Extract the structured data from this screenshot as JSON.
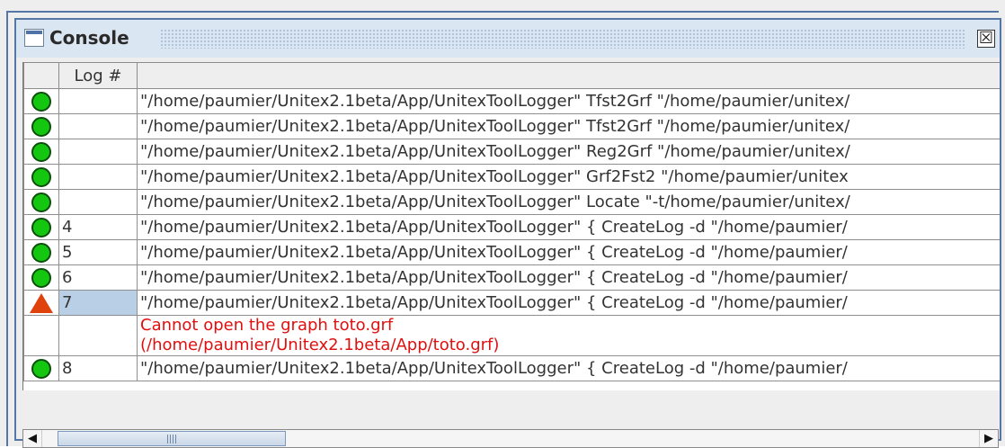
{
  "window": {
    "title": "Console",
    "close_icon": "close-icon"
  },
  "table": {
    "headers": [
      "",
      "Log #",
      ""
    ],
    "rows": [
      {
        "status": "ok",
        "log": "",
        "command": "\"/home/paumier/Unitex2.1beta/App/UnitexToolLogger\" Tfst2Grf \"/home/paumier/unitex/"
      },
      {
        "status": "ok",
        "log": "",
        "command": "\"/home/paumier/Unitex2.1beta/App/UnitexToolLogger\" Tfst2Grf \"/home/paumier/unitex/"
      },
      {
        "status": "ok",
        "log": "",
        "command": "\"/home/paumier/Unitex2.1beta/App/UnitexToolLogger\" Reg2Grf \"/home/paumier/unitex/"
      },
      {
        "status": "ok",
        "log": "",
        "command": "\"/home/paumier/Unitex2.1beta/App/UnitexToolLogger\" Grf2Fst2 \"/home/paumier/unitex"
      },
      {
        "status": "ok",
        "log": "",
        "command": "\"/home/paumier/Unitex2.1beta/App/UnitexToolLogger\" Locate \"-t/home/paumier/unitex/"
      },
      {
        "status": "ok",
        "log": "4",
        "command": "\"/home/paumier/Unitex2.1beta/App/UnitexToolLogger\" { CreateLog -d \"/home/paumier/"
      },
      {
        "status": "ok",
        "log": "5",
        "command": "\"/home/paumier/Unitex2.1beta/App/UnitexToolLogger\" { CreateLog -d \"/home/paumier/"
      },
      {
        "status": "ok",
        "log": "6",
        "command": "\"/home/paumier/Unitex2.1beta/App/UnitexToolLogger\" { CreateLog -d \"/home/paumier/"
      },
      {
        "status": "warning",
        "log": "7",
        "command": "\"/home/paumier/Unitex2.1beta/App/UnitexToolLogger\" { CreateLog -d \"/home/paumier/"
      },
      {
        "status": "",
        "log": "",
        "command": "Cannot open the graph toto.grf\n(/home/paumier/Unitex2.1beta/App/toto.grf)"
      },
      {
        "status": "ok",
        "log": "8",
        "command": "\"/home/paumier/Unitex2.1beta/App/UnitexToolLogger\" { CreateLog -d \"/home/paumier/"
      }
    ]
  },
  "scrollbar": {
    "left_icon": "arrow-left-icon",
    "right_icon": "arrow-right-icon",
    "position_percent": 0
  },
  "colors": {
    "window_border": "#5677a5",
    "titlebar": "#dbe6f3",
    "ok": "#15c611",
    "warning": "#e0420e",
    "error_text": "#e01010",
    "selection": "#b9cfe6"
  }
}
